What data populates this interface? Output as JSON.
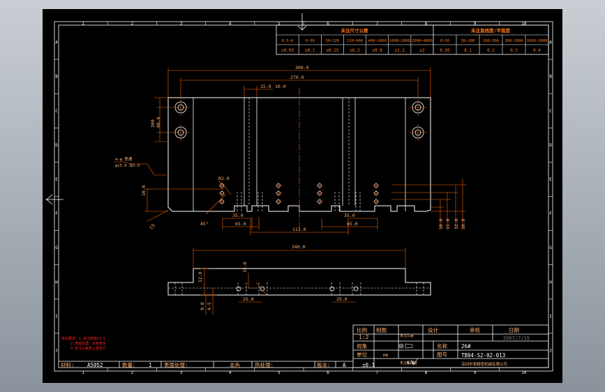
{
  "colors": {
    "background": "#000000",
    "frame": "#ffffff",
    "dimension": "#ff6600",
    "label": "#ffb070",
    "text_red": "#ff2020",
    "outline": "#ffffff",
    "hidden": "#ffffff"
  },
  "frame": {
    "columns": [
      "1",
      "2",
      "3",
      "4",
      "5",
      "6",
      "7",
      "8",
      "9",
      "10"
    ],
    "rows": [
      "A",
      "B",
      "C",
      "D",
      "E",
      "F",
      "G",
      "H",
      "I",
      "J"
    ]
  },
  "tolerance_table": {
    "linear_title": "未注尺寸公差",
    "flat_title": "未注直线度/平面度",
    "linear_ranges": [
      "0.5~6",
      "6~30",
      "30~120",
      "120~400",
      "400~1000",
      "1000~2000",
      "2000~4000"
    ],
    "linear_values": [
      "±0.05",
      "±0.1",
      "±0.15",
      "±0.2",
      "±0.8",
      "±1.2",
      "±2"
    ],
    "flat_ranges": [
      "0~30",
      "30~100",
      "100~300",
      "300~1000",
      "1000~3000"
    ],
    "flat_values": [
      "0.05",
      "0.1",
      "0.2",
      "0.3",
      "0.4"
    ]
  },
  "dimensions": {
    "d300": "300.0",
    "d270": "270.0",
    "d15": "15.0",
    "d10": "10.0",
    "d200": "200",
    "d80": "80.0",
    "hole_note_1": "4-φ 贯通",
    "hole_note_2": "φ15.0 深5.0",
    "r20": "R2.0",
    "d100": "10.0",
    "d45": "45°",
    "c5": "C5",
    "d35": "35.0",
    "d65": "65.0",
    "d112": "112.0",
    "d100b": "10.0",
    "d110": "11.0",
    "d120": "12.0",
    "d240": "240.0",
    "d25": "25.0",
    "d12": "12.0",
    "d9": "9.0",
    "d15b": "15.0",
    "d45b": "4.5"
  },
  "notes": {
    "line1": "技术要求：1.未注倒角C0.5",
    "line2": "2.表面处理：本色氧化",
    "line3": "3.未注公差按上表执行"
  },
  "title_block": {
    "scale_label": "比例",
    "scale_value": "1:2",
    "draw_label": "制图",
    "check_label": "设计",
    "audit_label": "审核",
    "date_label": "日期",
    "date_value": "2007/7/19",
    "view_label": "视角",
    "unit_label": "单位",
    "unit_value": "mm",
    "name_label": "名称",
    "name_value": "26#",
    "tol_label": "未注公差",
    "tol_value": "±0.1",
    "rough_label": "未注粗糙度",
    "rough_value": "6.3",
    "dwg_label": "图号",
    "dwg_value": "TB04-S2-02-013",
    "company": "深圳市某精密机械有限公司",
    "material_label": "材料:",
    "material_value": "A5052",
    "qty_label": "数量：",
    "qty_value": "1",
    "finish_label": "表面处理:",
    "finish_value": "本色",
    "heat_label": "热处理:",
    "rev_label": "版本:",
    "rev_value": "A"
  }
}
